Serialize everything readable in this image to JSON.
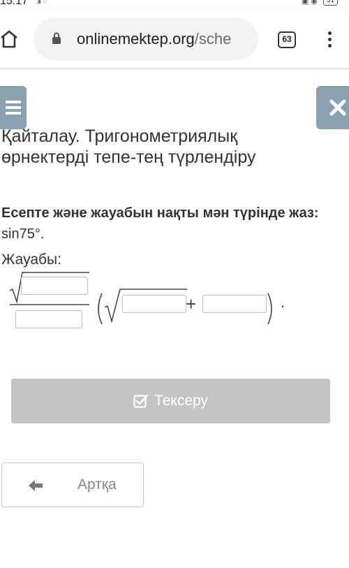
{
  "status_bar": {
    "time": "15:17",
    "battery": "31"
  },
  "browser": {
    "url_host": "onlinemektep.org",
    "url_path": "/sche",
    "tab_count": "63"
  },
  "page": {
    "title": "Қайталау. Тригонометриялық өрнектерді тепе-тең түрлендіру",
    "question_bold": "Есепте және жауабын нақты мән түрінде жаз:",
    "question_expr": " sin75°.",
    "answer_label": "Жауабы:",
    "plus": "+",
    "period": ".",
    "inputs": {
      "numerator_sqrt": "",
      "denominator": "",
      "inner_sqrt": "",
      "added_term": ""
    }
  },
  "buttons": {
    "check_label": "Тексеру",
    "back_label": "Артқа"
  },
  "colors": {
    "fab": "#8aa2b0",
    "check_button": "#c4c4c4",
    "url_bar": "#f1f3f4"
  }
}
